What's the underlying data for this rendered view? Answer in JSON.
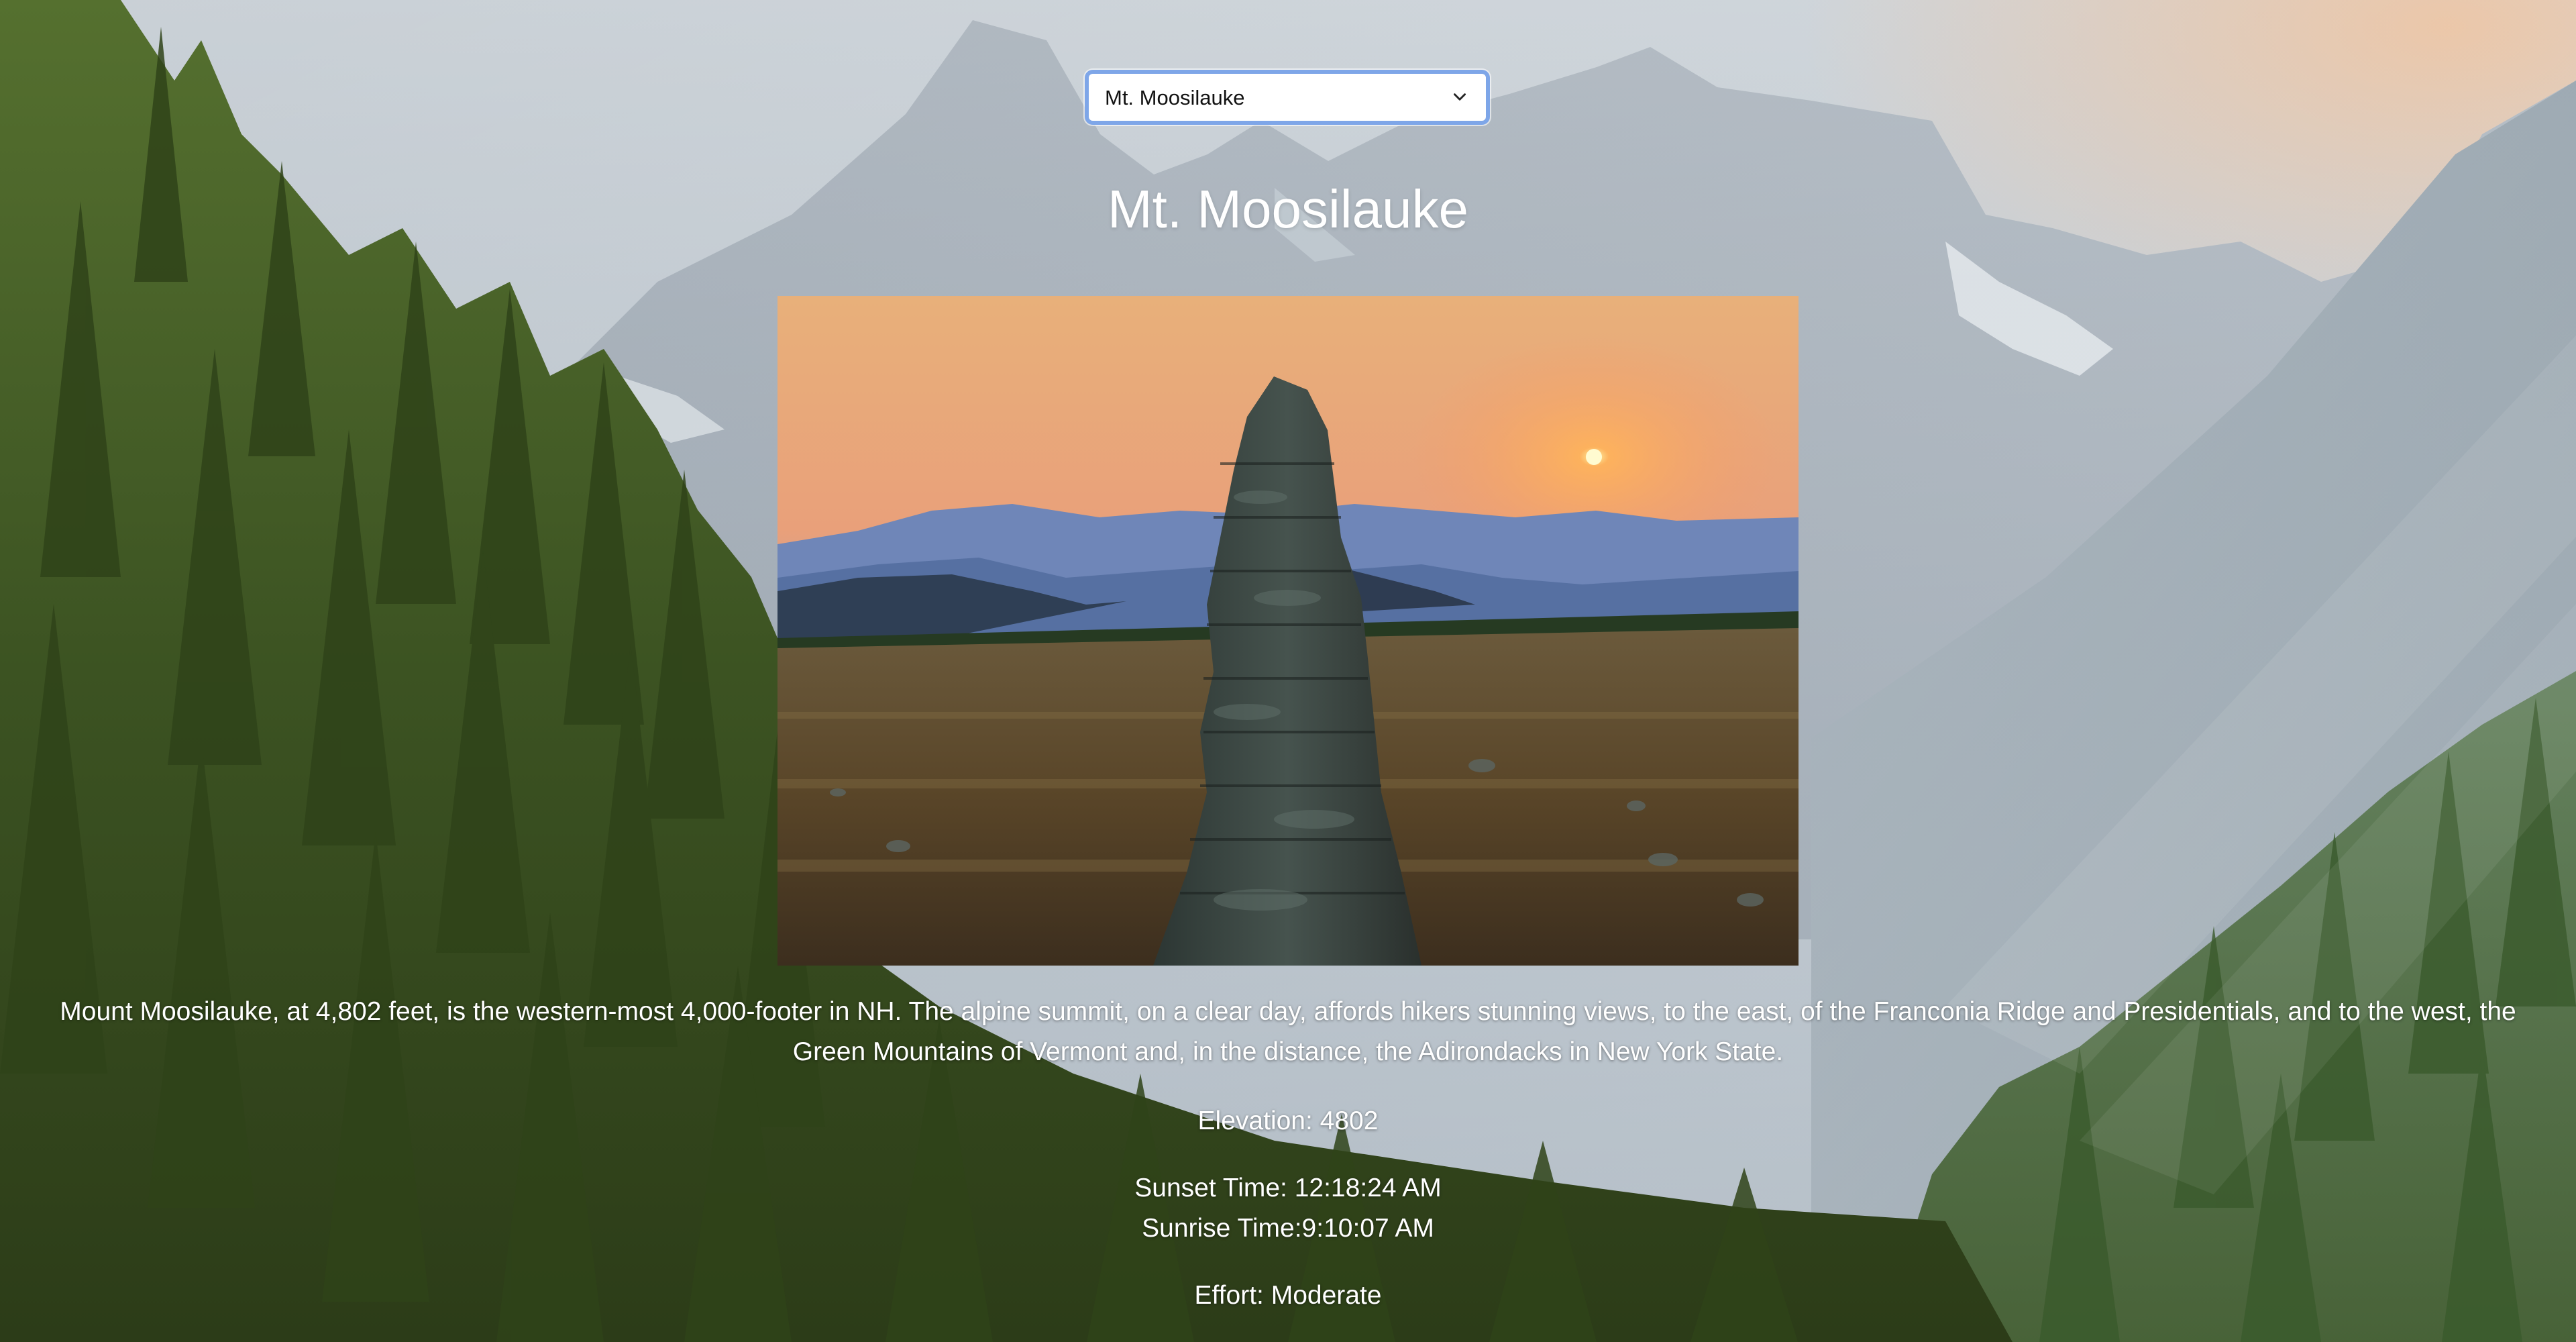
{
  "selector": {
    "selected": "Mt. Moosilauke",
    "options": [
      "Mt. Moosilauke"
    ]
  },
  "mountain": {
    "title": "Mt. Moosilauke",
    "description": "Mount Moosilauke, at 4,802 feet, is the western-most 4,000-footer in NH. The alpine summit, on a clear day, affords hikers stunning views, to the east, of the Franconia Ridge and Presidentials, and to the west, the Green Mountains of Vermont and, in the distance, the Adirondacks in New York State.",
    "elevation_label": "Elevation:",
    "elevation_value": "4802",
    "sunset_label": "Sunset Time:",
    "sunset_value": "12:18:24 AM",
    "sunrise_label": "Sunrise Time:",
    "sunrise_value": "9:10:07 AM",
    "effort_label": "Effort:",
    "effort_value": "Moderate"
  },
  "colors": {
    "select_focus_ring": "#7ea6e8",
    "text": "#ffffff",
    "sky": "#c4ccd3",
    "forest": "#3f5a24"
  },
  "icons": {
    "select_chevron": "chevron-down-icon"
  }
}
